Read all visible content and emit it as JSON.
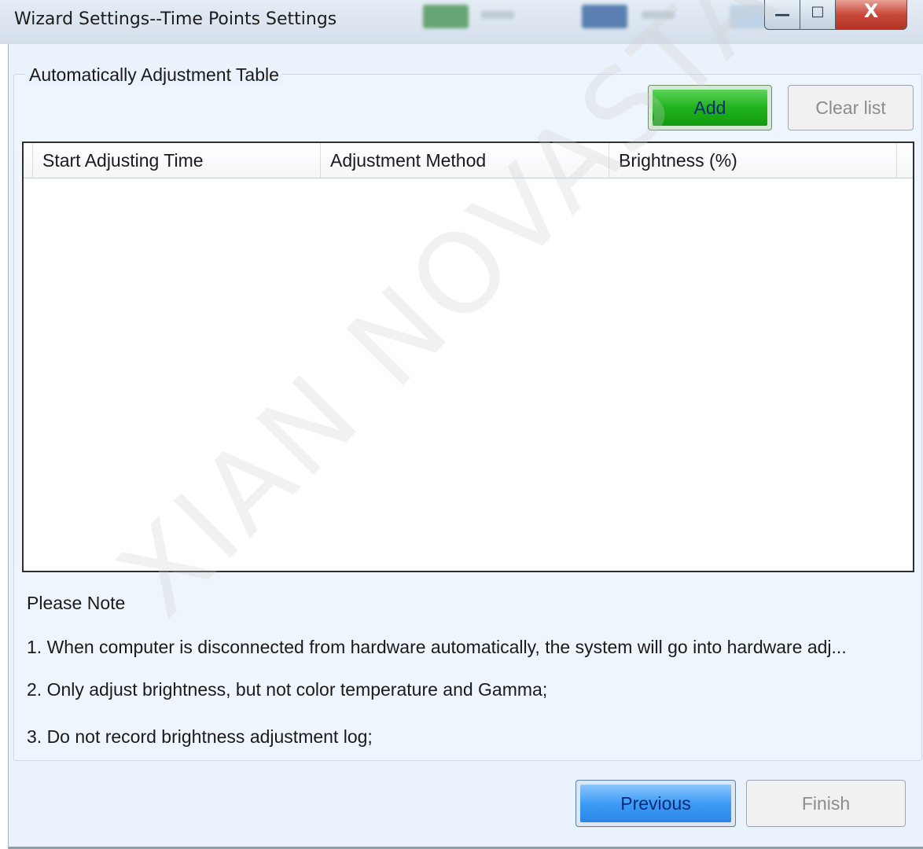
{
  "window": {
    "title": "Wizard Settings--Time Points Settings",
    "controls": {
      "minimize": "—",
      "maximize": "□",
      "close": "X"
    }
  },
  "group": {
    "title": "Automatically Adjustment Table",
    "add_label": "Add",
    "clear_label": "Clear list"
  },
  "table": {
    "columns": [
      "Start Adjusting Time",
      "Adjustment Method",
      "Brightness (%)"
    ],
    "rows": []
  },
  "notes": {
    "title": "Please Note",
    "items": [
      "1. When computer is disconnected from hardware automatically, the system will go into hardware adj...",
      "2. Only adjust brightness, but not color temperature and Gamma;",
      "3. Do not record brightness adjustment log;"
    ]
  },
  "footer": {
    "previous_label": "Previous",
    "finish_label": "Finish"
  },
  "watermark": "XIAN NOVASTAR TECH CO., LTD",
  "colors": {
    "add_green": "#1fb31c",
    "previous_blue": "#3d9cf5",
    "client_bg": "#eaf2fb",
    "close_red": "#c8493a"
  }
}
